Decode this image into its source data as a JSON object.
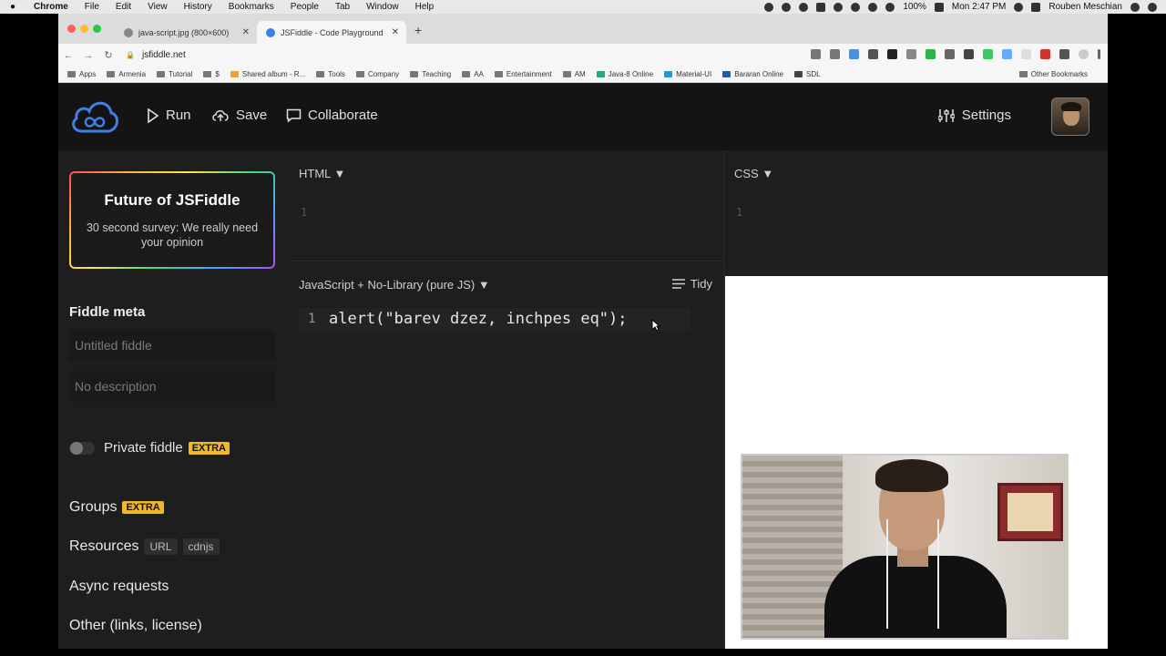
{
  "menubar": {
    "items": [
      "Chrome",
      "File",
      "Edit",
      "View",
      "History",
      "Bookmarks",
      "People",
      "Tab",
      "Window",
      "Help"
    ],
    "battery": "100%",
    "clock": "Mon 2:47 PM",
    "user": "Rouben Meschian"
  },
  "browser": {
    "tabs": [
      {
        "title": "java-script.jpg (800×600)",
        "active": false
      },
      {
        "title": "JSFiddle - Code Playground",
        "active": true
      }
    ],
    "url": "jsfiddle.net",
    "bookmarks": [
      "Apps",
      "Armenia",
      "Tutorial",
      "$",
      "Shared album - R...",
      "Tools",
      "Company",
      "Teaching",
      "AA",
      "Entertainment",
      "AM",
      "Java-8 Online",
      "Material-UI",
      "Bararan Online",
      "SDL"
    ],
    "other_bookmarks": "Other Bookmarks"
  },
  "header": {
    "run": "Run",
    "save": "Save",
    "collaborate": "Collaborate",
    "settings": "Settings"
  },
  "sidebar": {
    "promo_title": "Future of JSFiddle",
    "promo_sub": "30 second survey: We really need your opinion",
    "meta_heading": "Fiddle meta",
    "title_placeholder": "Untitled fiddle",
    "description_placeholder": "No description",
    "private_label": "Private fiddle",
    "extra_badge": "EXTRA",
    "groups": "Groups",
    "resources": "Resources",
    "url_tag": "URL",
    "cdnjs_tag": "cdnjs",
    "async": "Async requests",
    "other": "Other (links, license)"
  },
  "panels": {
    "html_label": "HTML ▼",
    "css_label": "CSS ▼",
    "js_label": "JavaScript + No-Library (pure JS) ▼",
    "tidy": "Tidy",
    "line_one": "1",
    "code": "alert(\"barev dzez, inchpes eq\");"
  },
  "colors": {
    "app_bg": "#1e1e1e",
    "header_bg": "#141414",
    "logo_blue": "#3f7fe6",
    "extra_badge": "#f0b928"
  }
}
